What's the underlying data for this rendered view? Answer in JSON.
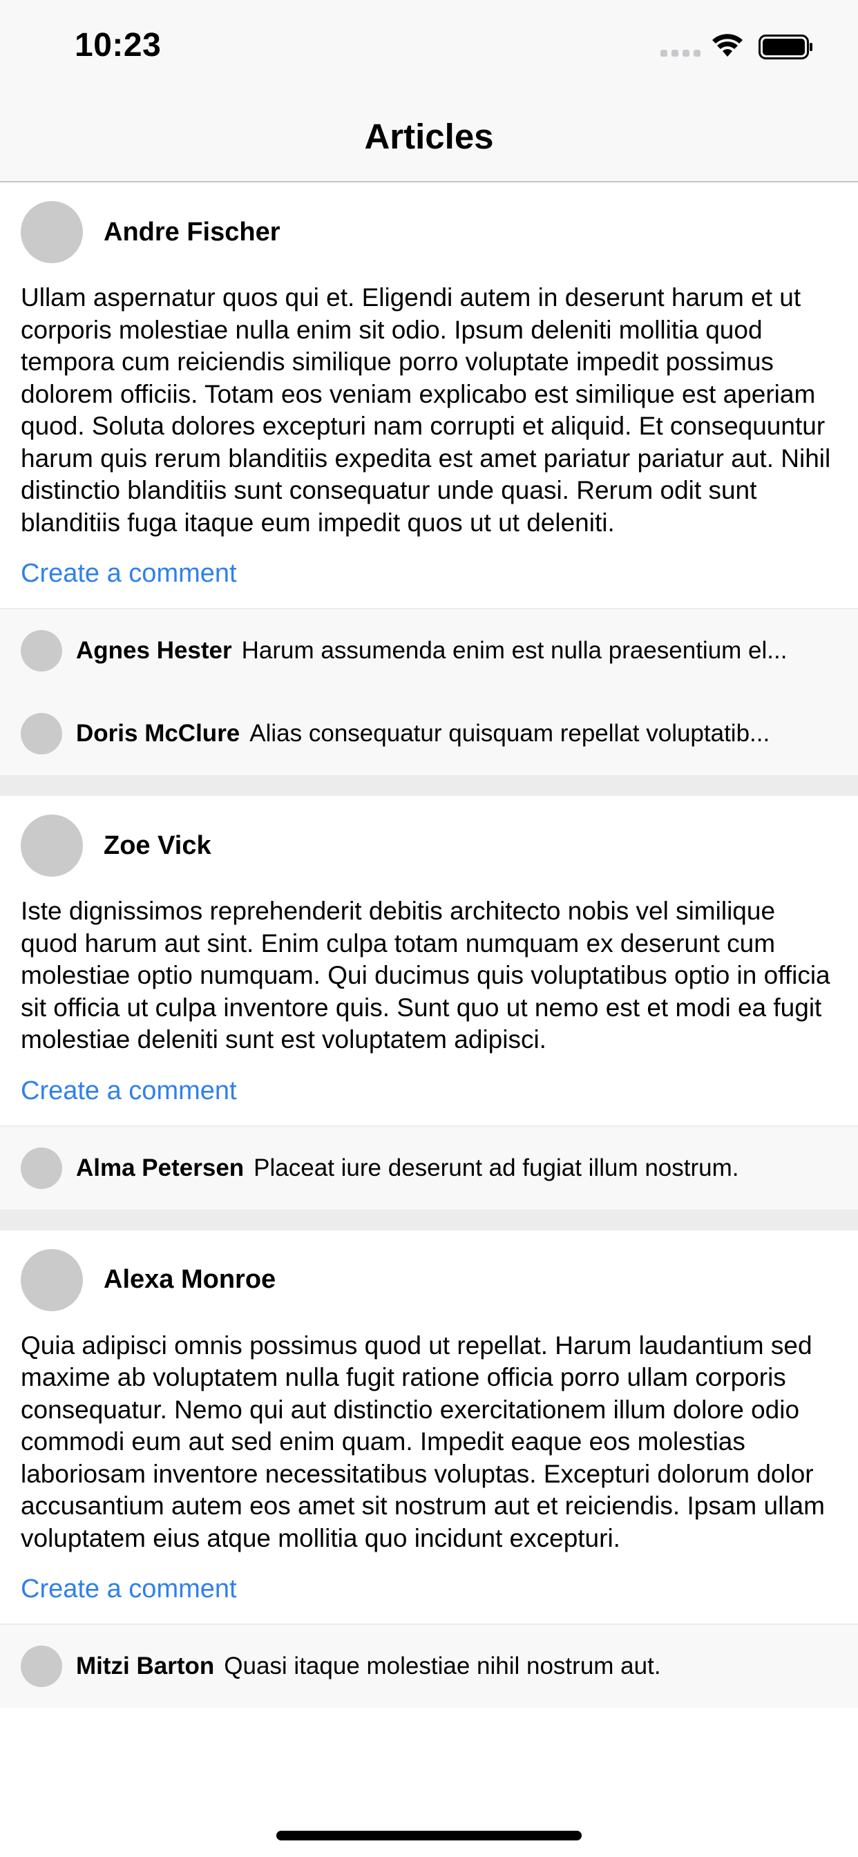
{
  "status_bar": {
    "time": "10:23"
  },
  "nav": {
    "title": "Articles"
  },
  "articles": [
    {
      "author": "Andre Fischer",
      "body": "Ullam aspernatur quos qui et. Eligendi autem in deserunt harum et ut corporis molestiae nulla enim sit odio. Ipsum deleniti mollitia quod tempora cum reiciendis similique porro voluptate impedit possimus dolorem officiis. Totam eos veniam explicabo est similique est aperiam quod. Soluta dolores excepturi nam corrupti et aliquid. Et consequuntur harum quis rerum blanditiis expedita est amet pariatur pariatur aut. Nihil distinctio blanditiis sunt consequatur unde quasi. Rerum odit sunt blanditiis fuga itaque eum impedit quos ut ut deleniti.",
      "action": "Create a comment",
      "comments": [
        {
          "author": "Agnes Hester",
          "text": "Harum assumenda enim est nulla praesentium el..."
        },
        {
          "author": "Doris McClure",
          "text": "Alias consequatur quisquam repellat voluptatib..."
        }
      ]
    },
    {
      "author": "Zoe Vick",
      "body": "Iste dignissimos reprehenderit debitis architecto nobis vel similique quod harum aut sint. Enim culpa totam numquam ex deserunt cum molestiae optio numquam. Qui ducimus quis voluptatibus optio in officia sit officia ut culpa inventore quis. Sunt quo ut nemo est et modi ea fugit molestiae deleniti sunt est voluptatem adipisci.",
      "action": "Create a comment",
      "comments": [
        {
          "author": "Alma Petersen",
          "text": "Placeat iure deserunt ad fugiat illum nostrum."
        }
      ]
    },
    {
      "author": "Alexa Monroe",
      "body": "Quia adipisci omnis possimus quod ut repellat. Harum laudantium sed maxime ab voluptatem nulla fugit ratione officia porro ullam corporis consequatur. Nemo qui aut distinctio exercitationem illum dolore odio commodi eum aut sed enim quam. Impedit eaque eos molestias laboriosam inventore necessitatibus voluptas. Excepturi dolorum dolor accusantium autem eos amet sit nostrum aut et reiciendis. Ipsam ullam voluptatem eius atque mollitia quo incidunt excepturi.",
      "action": "Create a comment",
      "comments": [
        {
          "author": "Mitzi Barton",
          "text": "Quasi itaque molestiae nihil nostrum aut."
        }
      ]
    }
  ],
  "colors": {
    "link": "#2f80ed",
    "avatar": "#cacaca",
    "separator": "#ececec",
    "bar_background": "#f8f8f8"
  },
  "icons": [
    "cellular-signal-icon",
    "wifi-icon",
    "battery-icon"
  ]
}
